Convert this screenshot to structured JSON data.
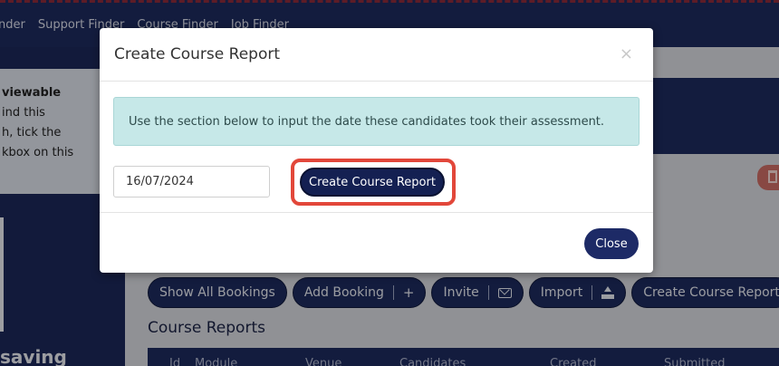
{
  "nav": {
    "items": [
      "nder",
      "Support Finder",
      "Course Finder",
      "Job Finder"
    ]
  },
  "sidebar": {
    "info_lines": [
      "viewable",
      "ind this",
      "h, tick the",
      "kbox on this"
    ],
    "saving_text": "saving"
  },
  "actions": {
    "show_all": "Show All Bookings",
    "add_booking": "Add Booking",
    "add_glyph": "+",
    "invite": "Invite",
    "import": "Import",
    "create_report": "Create Course Report"
  },
  "section": {
    "title": "Course Reports",
    "columns": [
      "Id",
      "Module",
      "Venue",
      "Candidates",
      "Created",
      "Submitted"
    ]
  },
  "modal": {
    "title": "Create Course Report",
    "close_glyph": "×",
    "alert_text": "Use the section below to input the date these candidates took their assessment.",
    "date_value": "16/07/2024",
    "submit_label": "Create Course Report",
    "close_label": "Close"
  },
  "colors": {
    "navy": "#1d2a5c",
    "highlight": "#e2473a",
    "alert_bg": "#c6e8e8"
  }
}
